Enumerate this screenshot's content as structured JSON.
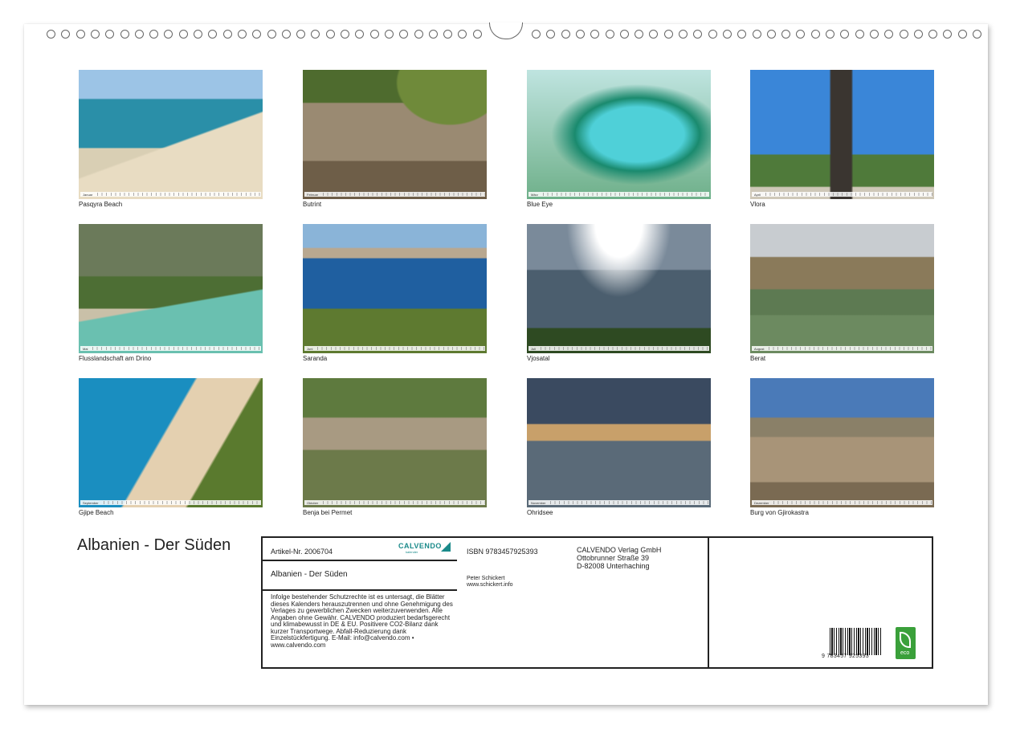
{
  "photos": [
    {
      "caption": "Pasqyra Beach",
      "month": "Januar",
      "theme": "beach"
    },
    {
      "caption": "Butrint",
      "month": "Februar",
      "theme": "ruins"
    },
    {
      "caption": "Blue Eye",
      "month": "März",
      "theme": "spring"
    },
    {
      "caption": "Vlora",
      "month": "April",
      "theme": "monument"
    },
    {
      "caption": "Flusslandschaft am Drino",
      "month": "Mai",
      "theme": "river"
    },
    {
      "caption": "Saranda",
      "month": "Juni",
      "theme": "bay"
    },
    {
      "caption": "Vjosatal",
      "month": "Juli",
      "theme": "valley"
    },
    {
      "caption": "Berat",
      "month": "August",
      "theme": "town"
    },
    {
      "caption": "Gjipe Beach",
      "month": "September",
      "theme": "beach2"
    },
    {
      "caption": "Benja bei Permet",
      "month": "Oktober",
      "theme": "bridge"
    },
    {
      "caption": "Ohridsee",
      "month": "November",
      "theme": "lake"
    },
    {
      "caption": "Burg von Gjirokastra",
      "month": "Dezember",
      "theme": "castle"
    }
  ],
  "title": "Albanien - Der Süden",
  "info": {
    "article": "Artikel-Nr. 2006704",
    "logo": "CALVENDO",
    "logo_sub": "kalender",
    "subtitle": "Albanien - Der Süden",
    "legal": "Infolge bestehender Schutzrechte ist es untersagt, die Blätter dieses Kalenders herauszutrennen und ohne Genehmigung des Verlages zu gewerblichen Zwecken weiterzuverwenden. Alle Angaben ohne Gewähr. CALVENDO produziert bedarfsgerecht und klimabewusst in DE & EU. Positivere CO2-Bilanz dank kurzer Transportwege. Abfall-Reduzierung dank Einzelstückfertigung. E-Mail: info@calvendo.com • www.calvendo.com",
    "isbn": "ISBN 9783457925393",
    "author": "Peter Schickert",
    "website": "www.schickert.info",
    "publisher_name": "CALVENDO Verlag GmbH",
    "publisher_street": "Ottobrunner Straße 39",
    "publisher_city": "D-82008 Unterhaching",
    "barcode_number": "9 783457 925393",
    "eco_label": "eco"
  }
}
